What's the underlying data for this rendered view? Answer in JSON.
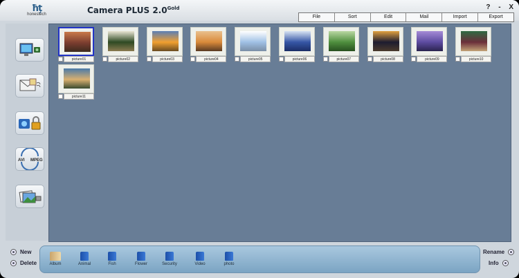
{
  "app": {
    "logo_text": "honestech",
    "title": "Camera PLUS 2.0",
    "title_suffix": "Gold",
    "help_label": "?",
    "minimize_label": "-",
    "close_label": "X"
  },
  "menu": [
    "File",
    "Sort",
    "Edit",
    "Mail",
    "Import",
    "Export"
  ],
  "tools": [
    {
      "name": "capture-to-pc-tool",
      "icon": "monitor-camera-icon"
    },
    {
      "name": "email-photo-tool",
      "icon": "envelope-stamp-icon"
    },
    {
      "name": "security-lock-tool",
      "icon": "camera-lock-icon"
    },
    {
      "name": "avi-mpeg-convert-tool",
      "icon": "avi-mpeg-convert-icon",
      "left": "AVI",
      "right": "MPEG"
    },
    {
      "name": "photo-album-tool",
      "icon": "photo-album-icon"
    }
  ],
  "pictures": [
    {
      "label": "picture01",
      "selected": true,
      "colors": [
        "#7b3d2f",
        "#c97a4a",
        "#3c2a1e"
      ]
    },
    {
      "label": "picture02",
      "selected": false,
      "colors": [
        "#2e4a23",
        "#e8e4d2",
        "#8a7a50"
      ]
    },
    {
      "label": "picture03",
      "selected": false,
      "colors": [
        "#f1a030",
        "#5b7fb5",
        "#6a4b21"
      ]
    },
    {
      "label": "picture04",
      "selected": false,
      "colors": [
        "#d98a3a",
        "#eac08d",
        "#5a3a22"
      ]
    },
    {
      "label": "picture05",
      "selected": false,
      "colors": [
        "#9fc0e5",
        "#ffffff",
        "#7a8ea6"
      ]
    },
    {
      "label": "picture06",
      "selected": false,
      "colors": [
        "#3656a6",
        "#d6e2f2",
        "#1a2d66"
      ]
    },
    {
      "label": "picture07",
      "selected": false,
      "colors": [
        "#4f8f3e",
        "#b9d7a2",
        "#27501f"
      ]
    },
    {
      "label": "picture08",
      "selected": false,
      "colors": [
        "#1d1c30",
        "#e0a040",
        "#4b3b2c"
      ]
    },
    {
      "label": "picture09",
      "selected": false,
      "colors": [
        "#5d4ba0",
        "#a58bd6",
        "#2a234f"
      ]
    },
    {
      "label": "picture10",
      "selected": false,
      "colors": [
        "#6b2e3a",
        "#2f6a43",
        "#c2a276"
      ]
    },
    {
      "label": "picture11",
      "selected": false,
      "colors": [
        "#d9b070",
        "#4a7aa8",
        "#3a4a30"
      ]
    }
  ],
  "bottom": {
    "new_label": "New",
    "delete_label": "Delete",
    "rename_label": "Rename",
    "info_label": "Info"
  },
  "albums": [
    "Album",
    "Animal",
    "Fish",
    "Flower",
    "Security",
    "Video",
    "photo"
  ]
}
